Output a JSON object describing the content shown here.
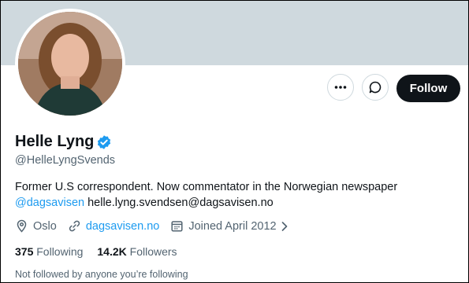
{
  "profile": {
    "name": "Helle Lyng",
    "handle": "@HelleLyngSvends",
    "bio_text": "Former U.S correspondent. Now commentator in the Norwegian newspaper",
    "bio_mention": "@dagsavisen",
    "bio_email": " helle.lyng.svendsen@dagsavisen.no",
    "location": "Oslo",
    "website": "dagsavisen.no",
    "joined": "Joined April 2012",
    "following_count": "375",
    "following_label": "Following",
    "followers_count": "14.2K",
    "followers_label": "Followers",
    "followed_by": "Not followed by anyone you’re following"
  },
  "actions": {
    "follow_label": "Follow",
    "more_icon": "more-icon",
    "message_icon": "message-icon"
  },
  "colors": {
    "banner": "#cfd9de",
    "accent": "#1d9bf0",
    "follow_bg": "#0f1419",
    "muted": "#536471"
  }
}
